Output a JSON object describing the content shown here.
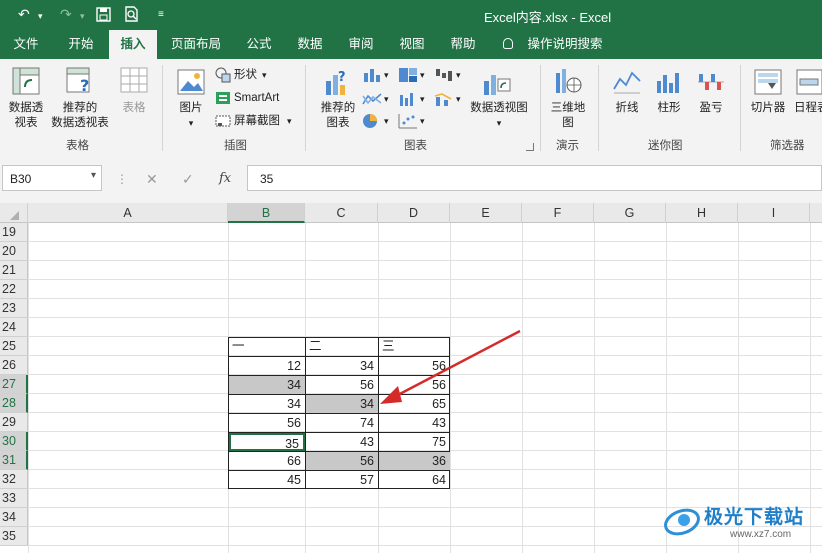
{
  "titlebar": {
    "title": "Excel内容.xlsx  -  Excel",
    "undo_icon": "undo-icon",
    "redo_icon": "redo-icon",
    "save_icon": "save-icon",
    "preview_icon": "print-preview-icon",
    "customize_icon": "customize-toolbar-icon"
  },
  "menu": {
    "tabs": [
      "文件",
      "开始",
      "插入",
      "页面布局",
      "公式",
      "数据",
      "审阅",
      "视图",
      "帮助"
    ],
    "active": "插入",
    "search": "操作说明搜索"
  },
  "ribbon": {
    "groups": {
      "tables": {
        "label": "表格",
        "pivot": [
          "数据透",
          "视表"
        ],
        "recommended_pivot": [
          "推荐的",
          "数据透视表"
        ],
        "table": "表格"
      },
      "illustrations": {
        "label": "插图",
        "pictures": "图片",
        "shapes": "形状",
        "smartart": "SmartArt",
        "screenshot": "屏幕截图"
      },
      "charts": {
        "label": "图表",
        "recommended": [
          "推荐的",
          "图表"
        ],
        "pivot_chart": "数据透视图"
      },
      "tours": {
        "label": "演示",
        "map3d": [
          "三维地",
          "图"
        ]
      },
      "sparklines": {
        "label": "迷你图",
        "line": "折线",
        "column": "柱形",
        "winloss": "盈亏"
      },
      "filters": {
        "label": "筛选器",
        "slicer": "切片器",
        "timeline": "日程表"
      }
    }
  },
  "formula_bar": {
    "name_box": "B30",
    "cancel": "✕",
    "enter": "✓",
    "fx": "fx",
    "value": "35"
  },
  "columns": [
    "A",
    "B",
    "C",
    "D",
    "E",
    "F",
    "G",
    "H",
    "I"
  ],
  "rows": [
    "19",
    "20",
    "21",
    "22",
    "23",
    "24",
    "25",
    "26",
    "27",
    "28",
    "29",
    "30",
    "31",
    "32",
    "33",
    "34",
    "35"
  ],
  "table": {
    "headers": [
      "一",
      "二",
      "三"
    ],
    "rows": [
      [
        "12",
        "34",
        "56"
      ],
      [
        "34",
        "56",
        "56"
      ],
      [
        "34",
        "34",
        "65"
      ],
      [
        "56",
        "74",
        "43"
      ],
      [
        "35",
        "43",
        "75"
      ],
      [
        "66",
        "56",
        "36"
      ],
      [
        "45",
        "57",
        "64"
      ]
    ]
  },
  "watermark": {
    "text": "极光下载站",
    "url": "www.xz7.com"
  }
}
